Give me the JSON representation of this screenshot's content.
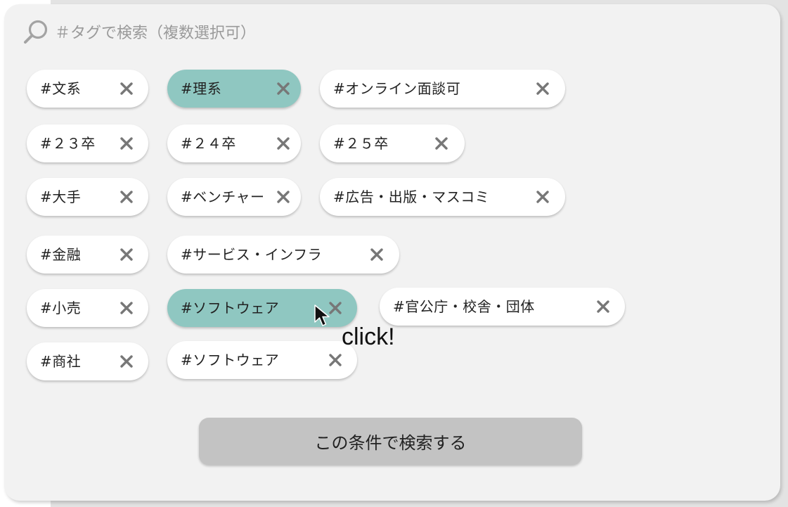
{
  "search": {
    "placeholder": "＃タグで検索（複数選択可）"
  },
  "tags": [
    {
      "label": "#文系",
      "selected": false
    },
    {
      "label": "#理系",
      "selected": true
    },
    {
      "label": "#オンライン面談可",
      "selected": false
    },
    {
      "label": "#２３卒",
      "selected": false
    },
    {
      "label": "#２４卒",
      "selected": false
    },
    {
      "label": "#２５卒",
      "selected": false
    },
    {
      "label": "#大手",
      "selected": false
    },
    {
      "label": "#ベンチャー",
      "selected": false
    },
    {
      "label": "#広告・出版・マスコミ",
      "selected": false
    },
    {
      "label": "#金融",
      "selected": false
    },
    {
      "label": "#サービス・インフラ",
      "selected": false
    },
    {
      "label": "#小売",
      "selected": false
    },
    {
      "label": "#ソフトウェア",
      "selected": true
    },
    {
      "label": "#官公庁・校舎・団体",
      "selected": false
    },
    {
      "label": "#商社",
      "selected": false
    },
    {
      "label": "#ソフトウェア",
      "selected": false
    }
  ],
  "annotation": {
    "click_label": "click!"
  },
  "search_button": {
    "label": "この条件で検索する"
  },
  "colors": {
    "selected_chip": "#8fc7c1",
    "chip": "#ffffff",
    "button": "#c3c3c3",
    "remove_icon": "#777777"
  },
  "icons": {
    "search": "search-icon",
    "remove": "close-icon",
    "cursor": "cursor-arrow-icon"
  }
}
